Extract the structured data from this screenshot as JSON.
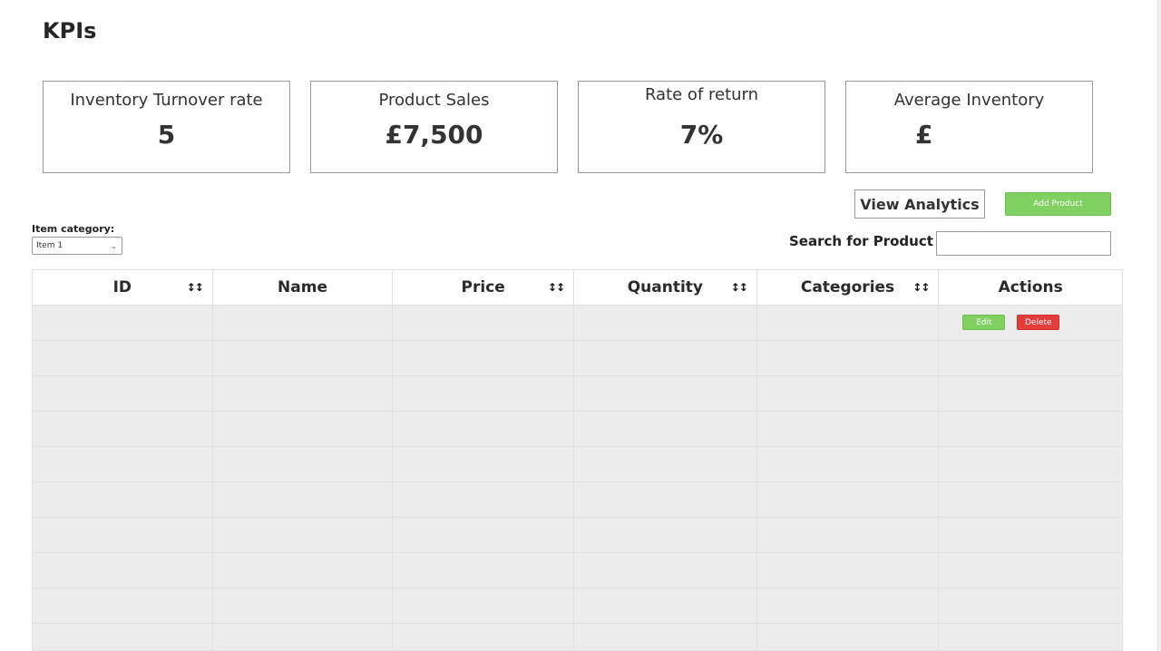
{
  "page": {
    "title": "KPIs"
  },
  "kpis": [
    {
      "label": "Inventory Turnover rate",
      "value": "5"
    },
    {
      "label": "Product Sales",
      "value": "£7,500"
    },
    {
      "label": "Rate of return",
      "value": "7%"
    },
    {
      "label": "Average Inventory",
      "value": "£"
    }
  ],
  "toolbar": {
    "view_analytics_label": "View Analytics",
    "add_product_label": "Add Product",
    "category_label": "Item category:",
    "category_selected": "Item 1",
    "search_label": "Search for Product",
    "search_value": ""
  },
  "table": {
    "columns": [
      {
        "label": "ID",
        "sortable": true
      },
      {
        "label": "Name",
        "sortable": false
      },
      {
        "label": "Price",
        "sortable": true
      },
      {
        "label": "Quantity",
        "sortable": true
      },
      {
        "label": "Categories",
        "sortable": true
      },
      {
        "label": "Actions",
        "sortable": false
      }
    ],
    "sort_icon": "sort-arrows-icon",
    "edit_label": "Edit",
    "delete_label": "Delete"
  },
  "colors": {
    "accent_green": "#80d062",
    "delete_red": "#e53b3b",
    "row_bg": "#ececec"
  }
}
